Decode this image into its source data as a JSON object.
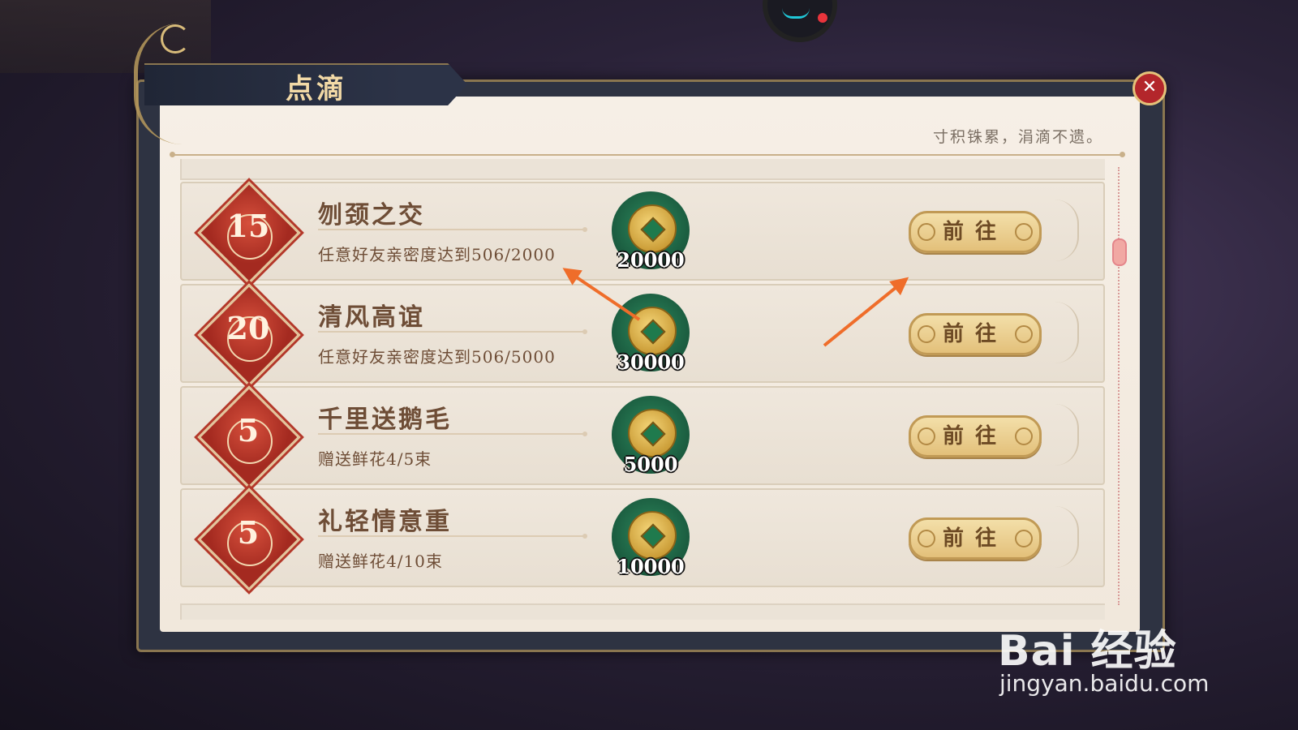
{
  "panel": {
    "title": "点滴",
    "motto": "寸积铢累，涓滴不遗。",
    "close_icon": "close-icon"
  },
  "tasks": [
    {
      "badge": "15",
      "name": "刎颈之交",
      "desc": "任意好友亲密度达到506/2000",
      "reward": "20000",
      "button": "前往"
    },
    {
      "badge": "20",
      "name": "清风高谊",
      "desc": "任意好友亲密度达到506/5000",
      "reward": "30000",
      "button": "前往"
    },
    {
      "badge": "5",
      "name": "千里送鹅毛",
      "desc": "赠送鲜花4/5束",
      "reward": "5000",
      "button": "前往"
    },
    {
      "badge": "5",
      "name": "礼轻情意重",
      "desc": "赠送鲜花4/10束",
      "reward": "10000",
      "button": "前往"
    }
  ],
  "watermark": {
    "brand": "Bai 经验",
    "url": "jingyan.baidu.com"
  },
  "colors": {
    "accent_orange": "#ef6d2a",
    "badge_red": "#b4382a",
    "coin_green": "#1a5a3e",
    "button_gold": "#e3c07a"
  }
}
